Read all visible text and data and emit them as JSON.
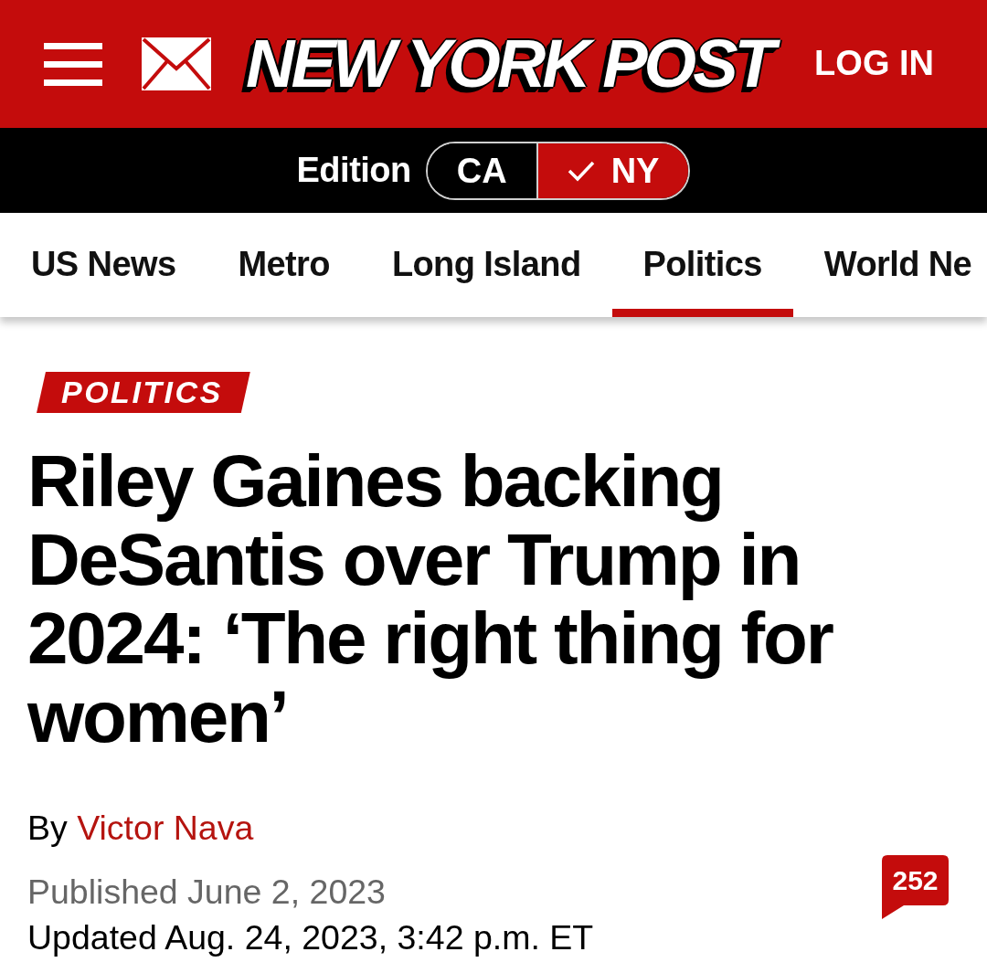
{
  "header": {
    "logo": "NEW YORK POST",
    "login": "LOG IN"
  },
  "edition": {
    "label": "Edition",
    "options": [
      {
        "label": "CA",
        "selected": false
      },
      {
        "label": "NY",
        "selected": true
      }
    ]
  },
  "nav": [
    {
      "label": "US News",
      "selected": false
    },
    {
      "label": "Metro",
      "selected": false
    },
    {
      "label": "Long Island",
      "selected": false
    },
    {
      "label": "Politics",
      "selected": true
    },
    {
      "label": "World Ne",
      "selected": false
    }
  ],
  "article": {
    "section": "POLITICS",
    "headline": "Riley Gaines backing DeSantis over Trump in 2024: ‘The right thing for women’",
    "byline_prefix": "By",
    "author": "Victor Nava",
    "published": "Published June 2, 2023",
    "updated": "Updated Aug. 24, 2023, 3:42 p.m. ET",
    "comment_count": "252"
  }
}
